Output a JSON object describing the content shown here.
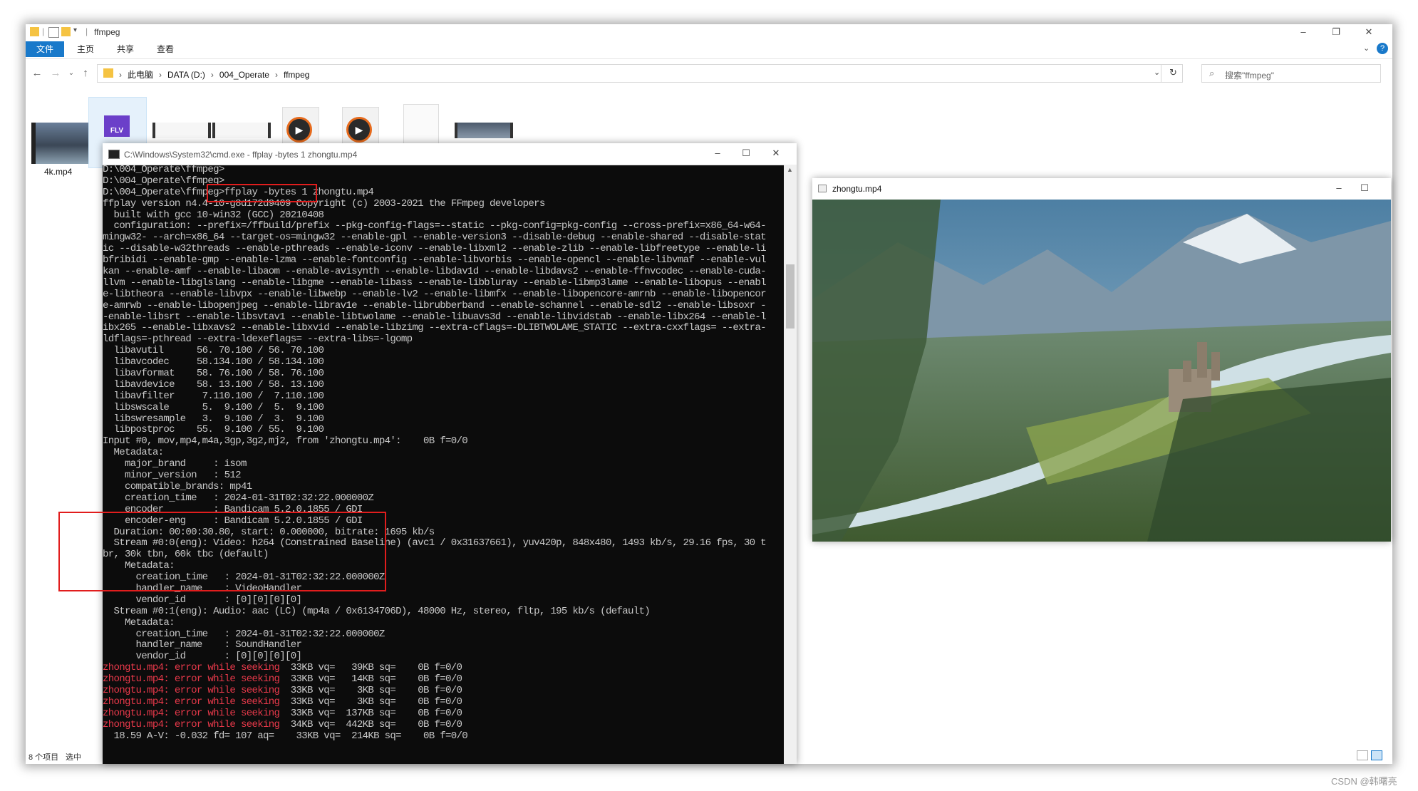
{
  "explorer": {
    "title": "ffmpeg",
    "ribbon_tabs": [
      "文件",
      "主页",
      "共享",
      "查看"
    ],
    "breadcrumbs": [
      "此电脑",
      "DATA (D:)",
      "004_Operate",
      "ffmpeg"
    ],
    "search_placeholder": "搜索\"ffmpeg\"",
    "thumbnail_label": "4k.mp4",
    "thumbnail_badge": "FLV",
    "status_count": "8 个项目",
    "status_selected": "选中"
  },
  "cmd": {
    "title": "C:\\Windows\\System32\\cmd.exe - ffplay  -bytes 1 zhongtu.mp4",
    "lines": [
      "D:\\004_Operate\\ffmpeg>",
      "D:\\004_Operate\\ffmpeg>",
      "D:\\004_Operate\\ffmpeg>ffplay -bytes 1 zhongtu.mp4",
      "ffplay version n4.4-10-g8d172d9409 Copyright (c) 2003-2021 the FFmpeg developers",
      "  built with gcc 10-win32 (GCC) 20210408",
      "  configuration: --prefix=/ffbuild/prefix --pkg-config-flags=--static --pkg-config=pkg-config --cross-prefix=x86_64-w64-",
      "mingw32- --arch=x86_64 --target-os=mingw32 --enable-gpl --enable-version3 --disable-debug --enable-shared --disable-stat",
      "ic --disable-w32threads --enable-pthreads --enable-iconv --enable-libxml2 --enable-zlib --enable-libfreetype --enable-li",
      "bfribidi --enable-gmp --enable-lzma --enable-fontconfig --enable-libvorbis --enable-opencl --enable-libvmaf --enable-vul",
      "kan --enable-amf --enable-libaom --enable-avisynth --enable-libdav1d --enable-libdavs2 --enable-ffnvcodec --enable-cuda-",
      "llvm --enable-libglslang --enable-libgme --enable-libass --enable-libbluray --enable-libmp3lame --enable-libopus --enabl",
      "e-libtheora --enable-libvpx --enable-libwebp --enable-lv2 --enable-libmfx --enable-libopencore-amrnb --enable-libopencor",
      "e-amrwb --enable-libopenjpeg --enable-librav1e --enable-librubberband --enable-schannel --enable-sdl2 --enable-libsoxr -",
      "-enable-libsrt --enable-libsvtav1 --enable-libtwolame --enable-libuavs3d --enable-libvidstab --enable-libx264 --enable-l",
      "ibx265 --enable-libxavs2 --enable-libxvid --enable-libzimg --extra-cflags=-DLIBTWOLAME_STATIC --extra-cxxflags= --extra-",
      "ldflags=-pthread --extra-ldexeflags= --extra-libs=-lgomp",
      "  libavutil      56. 70.100 / 56. 70.100",
      "  libavcodec     58.134.100 / 58.134.100",
      "  libavformat    58. 76.100 / 58. 76.100",
      "  libavdevice    58. 13.100 / 58. 13.100",
      "  libavfilter     7.110.100 /  7.110.100",
      "  libswscale      5.  9.100 /  5.  9.100",
      "  libswresample   3.  9.100 /  3.  9.100",
      "  libpostproc    55.  9.100 / 55.  9.100",
      "Input #0, mov,mp4,m4a,3gp,3g2,mj2, from 'zhongtu.mp4':    0B f=0/0",
      "  Metadata:",
      "    major_brand     : isom",
      "    minor_version   : 512",
      "    compatible_brands: mp41",
      "    creation_time   : 2024-01-31T02:32:22.000000Z",
      "    encoder         : Bandicam 5.2.0.1855 / GDI",
      "    encoder-eng     : Bandicam 5.2.0.1855 / GDI",
      "  Duration: 00:00:30.80, start: 0.000000, bitrate: 1695 kb/s",
      "  Stream #0:0(eng): Video: h264 (Constrained Baseline) (avc1 / 0x31637661), yuv420p, 848x480, 1493 kb/s, 29.16 fps, 30 t",
      "br, 30k tbn, 60k tbc (default)",
      "    Metadata:",
      "      creation_time   : 2024-01-31T02:32:22.000000Z",
      "      handler_name    : VideoHandler",
      "      vendor_id       : [0][0][0][0]",
      "  Stream #0:1(eng): Audio: aac (LC) (mp4a / 0x6134706D), 48000 Hz, stereo, fltp, 195 kb/s (default)",
      "    Metadata:",
      "      creation_time   : 2024-01-31T02:32:22.000000Z",
      "      handler_name    : SoundHandler",
      "      vendor_id       : [0][0][0][0]"
    ],
    "error_lines": [
      "zhongtu.mp4: error while seeking",
      "zhongtu.mp4: error while seeking",
      "zhongtu.mp4: error while seeking",
      "zhongtu.mp4: error while seeking",
      "zhongtu.mp4: error while seeking",
      "zhongtu.mp4: error while seeking"
    ],
    "error_stats": [
      "  33KB vq=   39KB sq=    0B f=0/0",
      "  33KB vq=   14KB sq=    0B f=0/0",
      "  33KB vq=    3KB sq=    0B f=0/0",
      "  33KB vq=    3KB sq=    0B f=0/0",
      "  33KB vq=  137KB sq=    0B f=0/0",
      "  34KB vq=  442KB sq=    0B f=0/0"
    ],
    "last_line": "  18.59 A-V: -0.032 fd= 107 aq=    33KB vq=  214KB sq=    0B f=0/0"
  },
  "video_window": {
    "title": "zhongtu.mp4"
  },
  "watermark": "CSDN @韩曙亮"
}
